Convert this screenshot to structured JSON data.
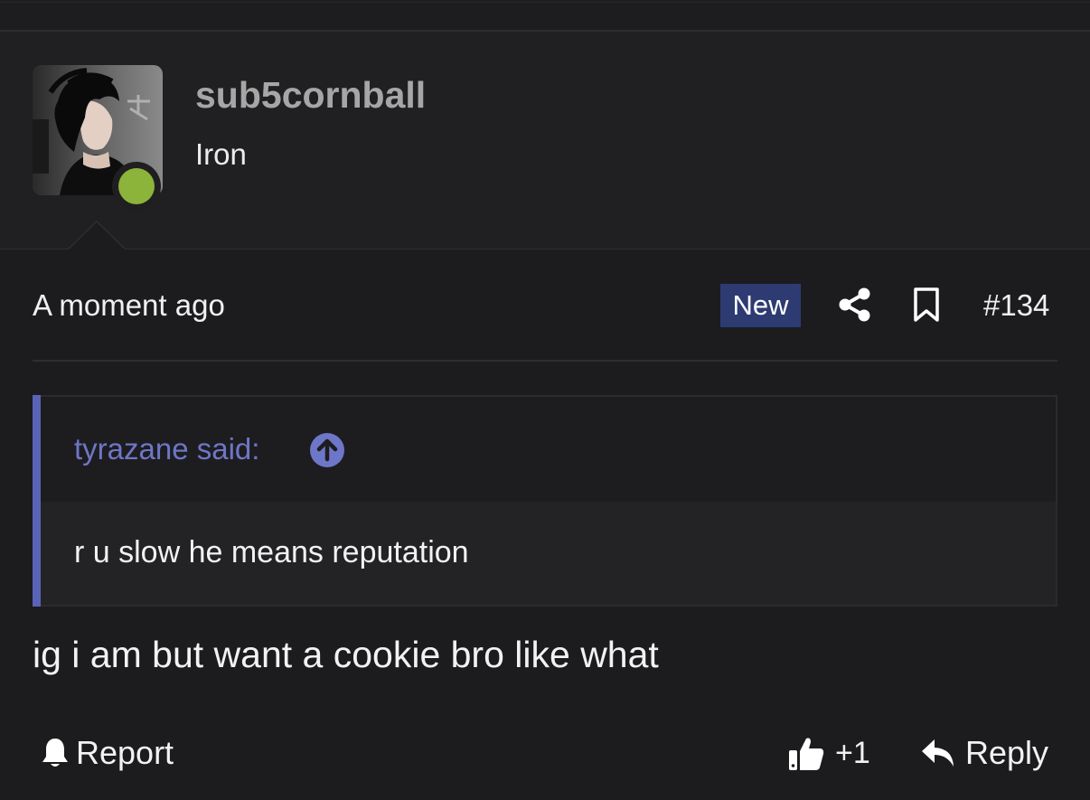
{
  "user": {
    "name": "sub5cornball",
    "title": "Iron",
    "online": true
  },
  "post": {
    "time": "A moment ago",
    "badge": "New",
    "number": "#134",
    "message": "ig i am but want a cookie bro like what"
  },
  "quote": {
    "author_line": "tyrazane said:",
    "text": "r u slow he means reputation"
  },
  "actions": {
    "report_label": "Report",
    "like_count": "+1",
    "reply_label": "Reply"
  },
  "icons": {
    "share": "share-icon",
    "bookmark": "bookmark-icon",
    "quote_jump": "arrow-up-circle-icon",
    "report": "bell-icon",
    "like": "thumbs-up-icon",
    "reply": "reply-arrow-icon"
  },
  "colors": {
    "background": "#1c1c1e",
    "online": "#8cb33a",
    "quote_accent": "#5a63b8",
    "quote_author": "#6e76c8",
    "new_badge": "#2d3b72"
  }
}
